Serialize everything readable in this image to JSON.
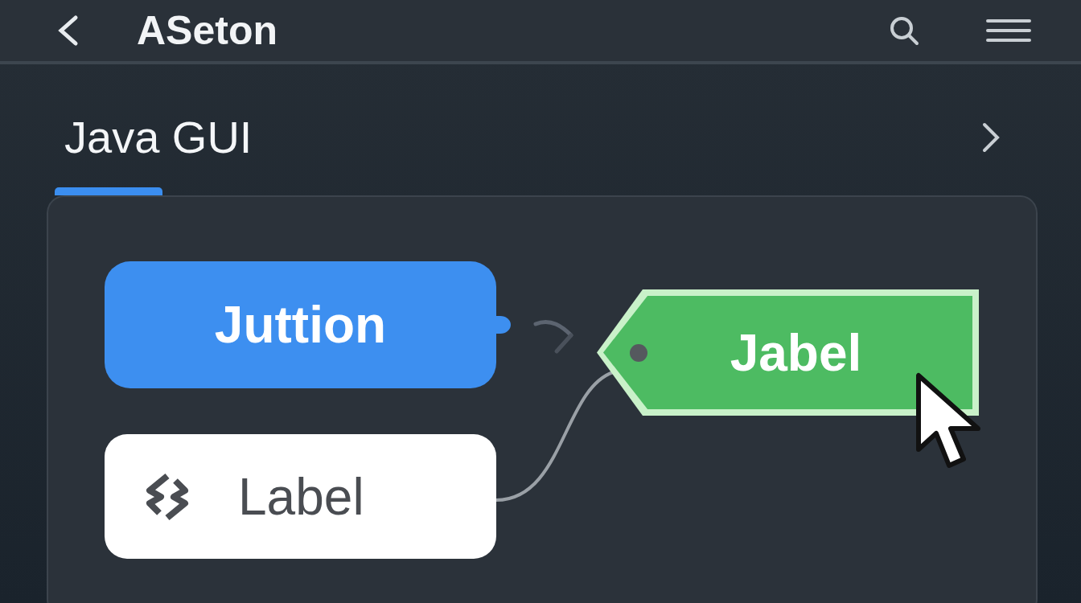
{
  "header": {
    "title": "ASeton"
  },
  "section": {
    "title": "Java GUI"
  },
  "nodes": [
    {
      "kind": "bubble",
      "label": "Juttion"
    },
    {
      "kind": "tag",
      "label": "Jabel"
    },
    {
      "kind": "chip",
      "label": "Label"
    }
  ]
}
